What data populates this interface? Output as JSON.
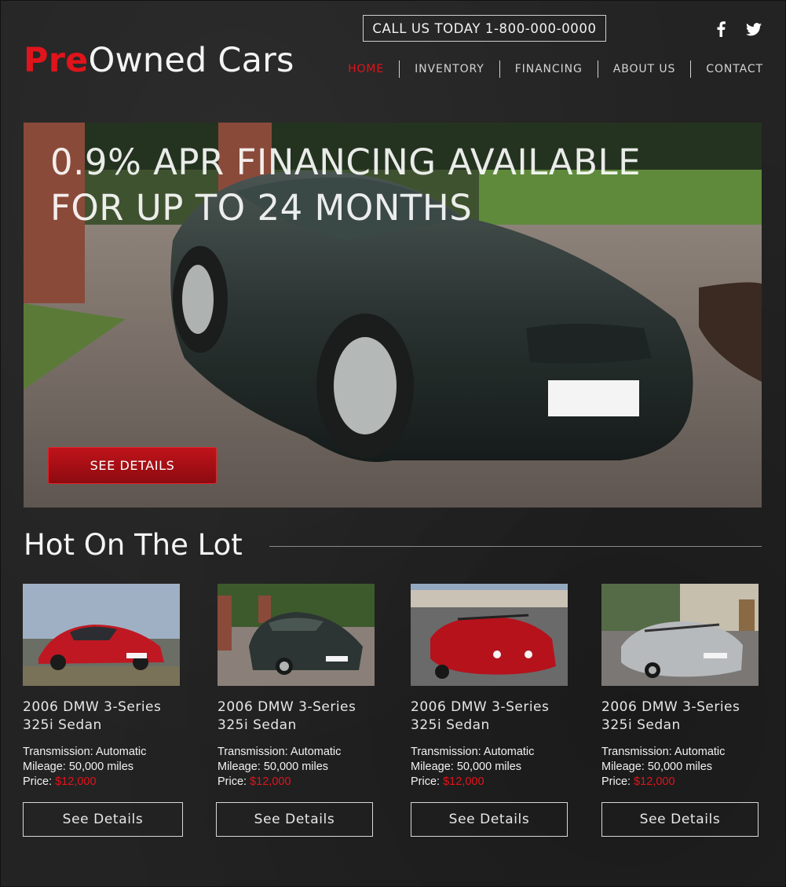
{
  "header": {
    "phone_cta": "CALL US TODAY 1-800-000-0000",
    "logo_pre": "Pre",
    "logo_rest": "Owned Cars",
    "social": [
      {
        "icon": "facebook-icon"
      },
      {
        "icon": "twitter-icon"
      }
    ]
  },
  "nav": {
    "items": [
      {
        "label": "HOME",
        "active": true
      },
      {
        "label": "INVENTORY"
      },
      {
        "label": "FINANCING"
      },
      {
        "label": "ABOUT US"
      },
      {
        "label": "CONTACT"
      }
    ]
  },
  "hero": {
    "line1": "0.9% APR FINANCING AVAILABLE",
    "line2": "FOR UP TO 24 MONTHS",
    "button": "SEE DETAILS"
  },
  "section": {
    "title": "Hot On The Lot"
  },
  "listings": [
    {
      "name_line1": "2006 DMW 3-Series",
      "name_line2": "325i Sedan",
      "transmission": "Transmission: Automatic",
      "mileage": "Mileage: 50,000 miles",
      "price_label": "Price: ",
      "price": "$12,000",
      "button": "See Details"
    },
    {
      "name_line1": "2006 DMW 3-Series",
      "name_line2": "325i Sedan",
      "transmission": "Transmission: Automatic",
      "mileage": "Mileage: 50,000 miles",
      "price_label": "Price: ",
      "price": "$12,000",
      "button": "See Details"
    },
    {
      "name_line1": "2006 DMW 3-Series",
      "name_line2": "325i Sedan",
      "transmission": "Transmission: Automatic",
      "mileage": "Mileage: 50,000 miles",
      "price_label": "Price: ",
      "price": "$12,000",
      "button": "See Details"
    },
    {
      "name_line1": "2006 DMW 3-Series",
      "name_line2": "325i Sedan",
      "transmission": "Transmission: Automatic",
      "mileage": "Mileage: 50,000 miles",
      "price_label": "Price: ",
      "price": "$12,000",
      "button": "See Details"
    }
  ],
  "colors": {
    "accent": "#e0141b",
    "background": "#232323",
    "text": "#f4f4f4"
  }
}
